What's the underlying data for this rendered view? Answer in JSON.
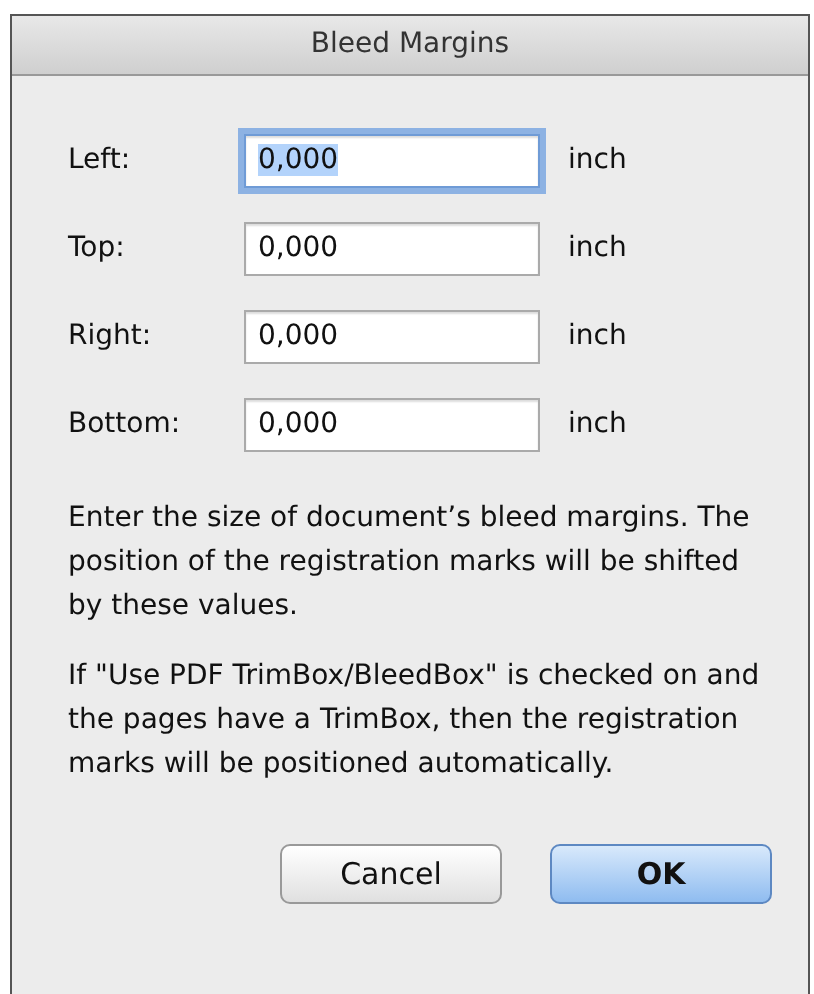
{
  "window": {
    "title": "Bleed Margins"
  },
  "fields": [
    {
      "label": "Left:",
      "value": "0,000",
      "unit": "inch",
      "focused": true
    },
    {
      "label": "Top:",
      "value": "0,000",
      "unit": "inch",
      "focused": false
    },
    {
      "label": "Right:",
      "value": "0,000",
      "unit": "inch",
      "focused": false
    },
    {
      "label": "Bottom:",
      "value": "0,000",
      "unit": "inch",
      "focused": false
    }
  ],
  "paragraphs": [
    "Enter the size of document’s bleed margins. The position of the registration marks will be shifted by these values.",
    "If \"Use PDF TrimBox/BleedBox\" is checked on and the pages have a TrimBox, then the registration marks will be positioned automatically."
  ],
  "buttons": [
    {
      "label": "Cancel",
      "default": false
    },
    {
      "label": "OK",
      "default": true
    }
  ]
}
